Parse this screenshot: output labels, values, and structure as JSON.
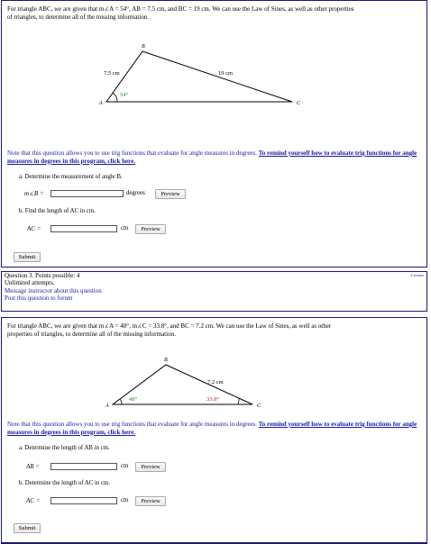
{
  "question2": {
    "prompt_line1": "For triangle ABC, we are given that m∠A = 54°, AB = 7.5 cm, and BC = 19 cm. We can use the Law of Sines, as well as other properties",
    "prompt_line2": "of triangles, to determine all of the missing information.",
    "diagram": {
      "vertex_a": "A",
      "vertex_b": "B",
      "vertex_c": "C",
      "side_ab": "7.5 cm",
      "side_bc": "19 cm",
      "angle_a": "54°",
      "angle_a_color": "#2e8b2e"
    },
    "note_text": "Note that this question allows you to use trig functions that evaluate for angle measures in degrees.",
    "note_link_line1": "To remind yourself how to evaluate trig",
    "note_link_line2": "functions for angle measures in degrees in this program, click here.",
    "part_a_label": "a. Determine the measurement of angle B.",
    "part_a_var": "m∠B =",
    "part_a_value": "",
    "part_a_unit": "degrees",
    "part_b_label": "b. Find the length of AC in cm.",
    "part_b_var": "AC =",
    "part_b_value": "",
    "part_b_unit": "cm",
    "preview_label": "Preview",
    "submit_label": "Submit"
  },
  "info": {
    "points_line": "Question 3. Points possible: 4",
    "attempts_line": "Unlimited attempts.",
    "message_link": "Message instructor about this question",
    "forum_link": "Post this question to forum",
    "license_link": "License"
  },
  "question3": {
    "prompt_line1": "For triangle ABC, we are given that m∠A = 48°, m∠C = 33.8°, and BC = 7.2 cm. We can use the Law of Sines, as well as other",
    "prompt_line2": "properties of triangles, to determine all of the missing information.",
    "diagram": {
      "vertex_a": "A",
      "vertex_b": "B",
      "vertex_c": "C",
      "side_bc": "7.2 cm",
      "angle_a": "48°",
      "angle_c": "33.8°",
      "angle_a_color": "#2e8b2e",
      "angle_c_color": "#cc2222"
    },
    "note_text": "Note that this question allows you to use trig functions that evaluate for angle measures in degrees.",
    "note_link_line1": "To remind yourself how to evaluate trig",
    "note_link_line2": "functions for angle measures in degrees in this program, click here.",
    "part_a_label": "a. Determine the length of AB in cm.",
    "part_a_var": "AB =",
    "part_a_value": "",
    "part_a_unit": "cm",
    "part_b_label": "b. Determine the length of AC in cm.",
    "part_b_var": "AC =",
    "part_b_value": "",
    "part_b_unit": "cm",
    "preview_label": "Preview",
    "submit_label": "Submit"
  }
}
